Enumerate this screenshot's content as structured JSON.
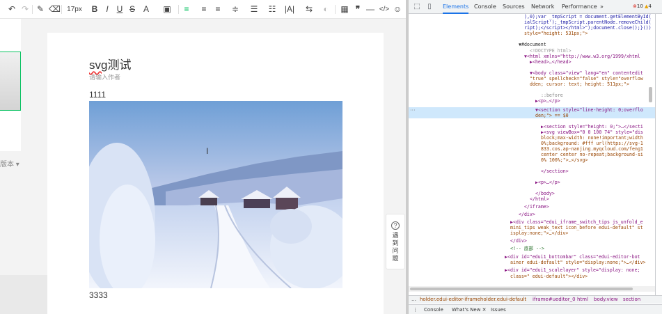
{
  "editor": {
    "toolbar": {
      "undo_icon": "undo-icon",
      "redo_icon": "redo-icon",
      "font_size": "17px",
      "bold": "B",
      "italic": "I",
      "underline": "U",
      "strikethrough": "S",
      "font_color": "A",
      "quote": "❞",
      "code": "</>"
    },
    "version_label": "版本",
    "document": {
      "title_svg": "svg",
      "title_rest": "测试",
      "author_placeholder": "请输入作者",
      "para_1": "1111",
      "para_2": "3333"
    },
    "feedback": {
      "chars": [
        "遇",
        "到",
        "问",
        "题"
      ]
    }
  },
  "devtools": {
    "tabs": [
      "Elements",
      "Console",
      "Sources",
      "Network",
      "Performance",
      "»"
    ],
    "active_tab": "Elements",
    "error_count": "10",
    "warning_count": "4",
    "dom_lines": [
      "),0);var _tmpScript = document.getElementById(",
      "ialScript');_tmpScript.parentNode.removeChild(",
      "ript);</script></html>\");document.close();}())",
      "style=\"height: 531px;\">",
      "▼#document",
      "<!DOCTYPE html>",
      "▼<html xmlns=\"http://www.w3.org/1999/xhtml",
      "▶<head>…</head>",
      "▼<body class=\"view\" lang=\"en\" contentedit",
      "\"true\" spellcheck=\"false\" style=\"overflow",
      "dden; cursor: text; height: 511px;\">",
      "::before",
      "▶<p>…</p>",
      "▼<section style=\"line-height: 0;overflo",
      "den;\"> == $0",
      "▶<section style=\"height: 0;\">…</secti",
      "▶<svg viewBox=\"0 0 100 74\" style=\"dis",
      "block;max-width: none!important;width",
      "0%;background: #fff url(https://svg-1",
      "833.cos.ap-nanjing.myqcloud.com/feng1",
      "center center no-repeat;background-si",
      "0% 100%;\">…</svg>",
      "</section>",
      "▶<p>…</p>",
      "</body>",
      "</html>",
      "</iframe>",
      "</div>",
      "▶<div class=\"edui_iframe_switch_tips js_unfold_e",
      "mini_tips weak_text icon_before edui-default\" st",
      "isplay:none;\">…</div>",
      "</div>",
      "<!-- 底部 -->",
      "▶<div id=\"edui1_bottombar\" class=\"edui-editor-bot",
      "ainer edui-default\" style=\"display:none;\">…</div>",
      "▶<div id=\"edui1_scalelayer\" style=\"display: none;",
      "class=\" edui-default\"></div>"
    ],
    "breadcrumbs": [
      "…",
      "holder.edui-editor-iframeholder.edui-default",
      "iframe#ueditor_0",
      "html",
      "body.view",
      "section"
    ],
    "drawer_tabs": [
      "⋮",
      "Console",
      "What's New ✕",
      "Issues"
    ],
    "colors": {
      "selected_row": "#cfe8fc",
      "tag": "#881280",
      "attr": "#994500",
      "accent": "#1a73e8"
    }
  }
}
